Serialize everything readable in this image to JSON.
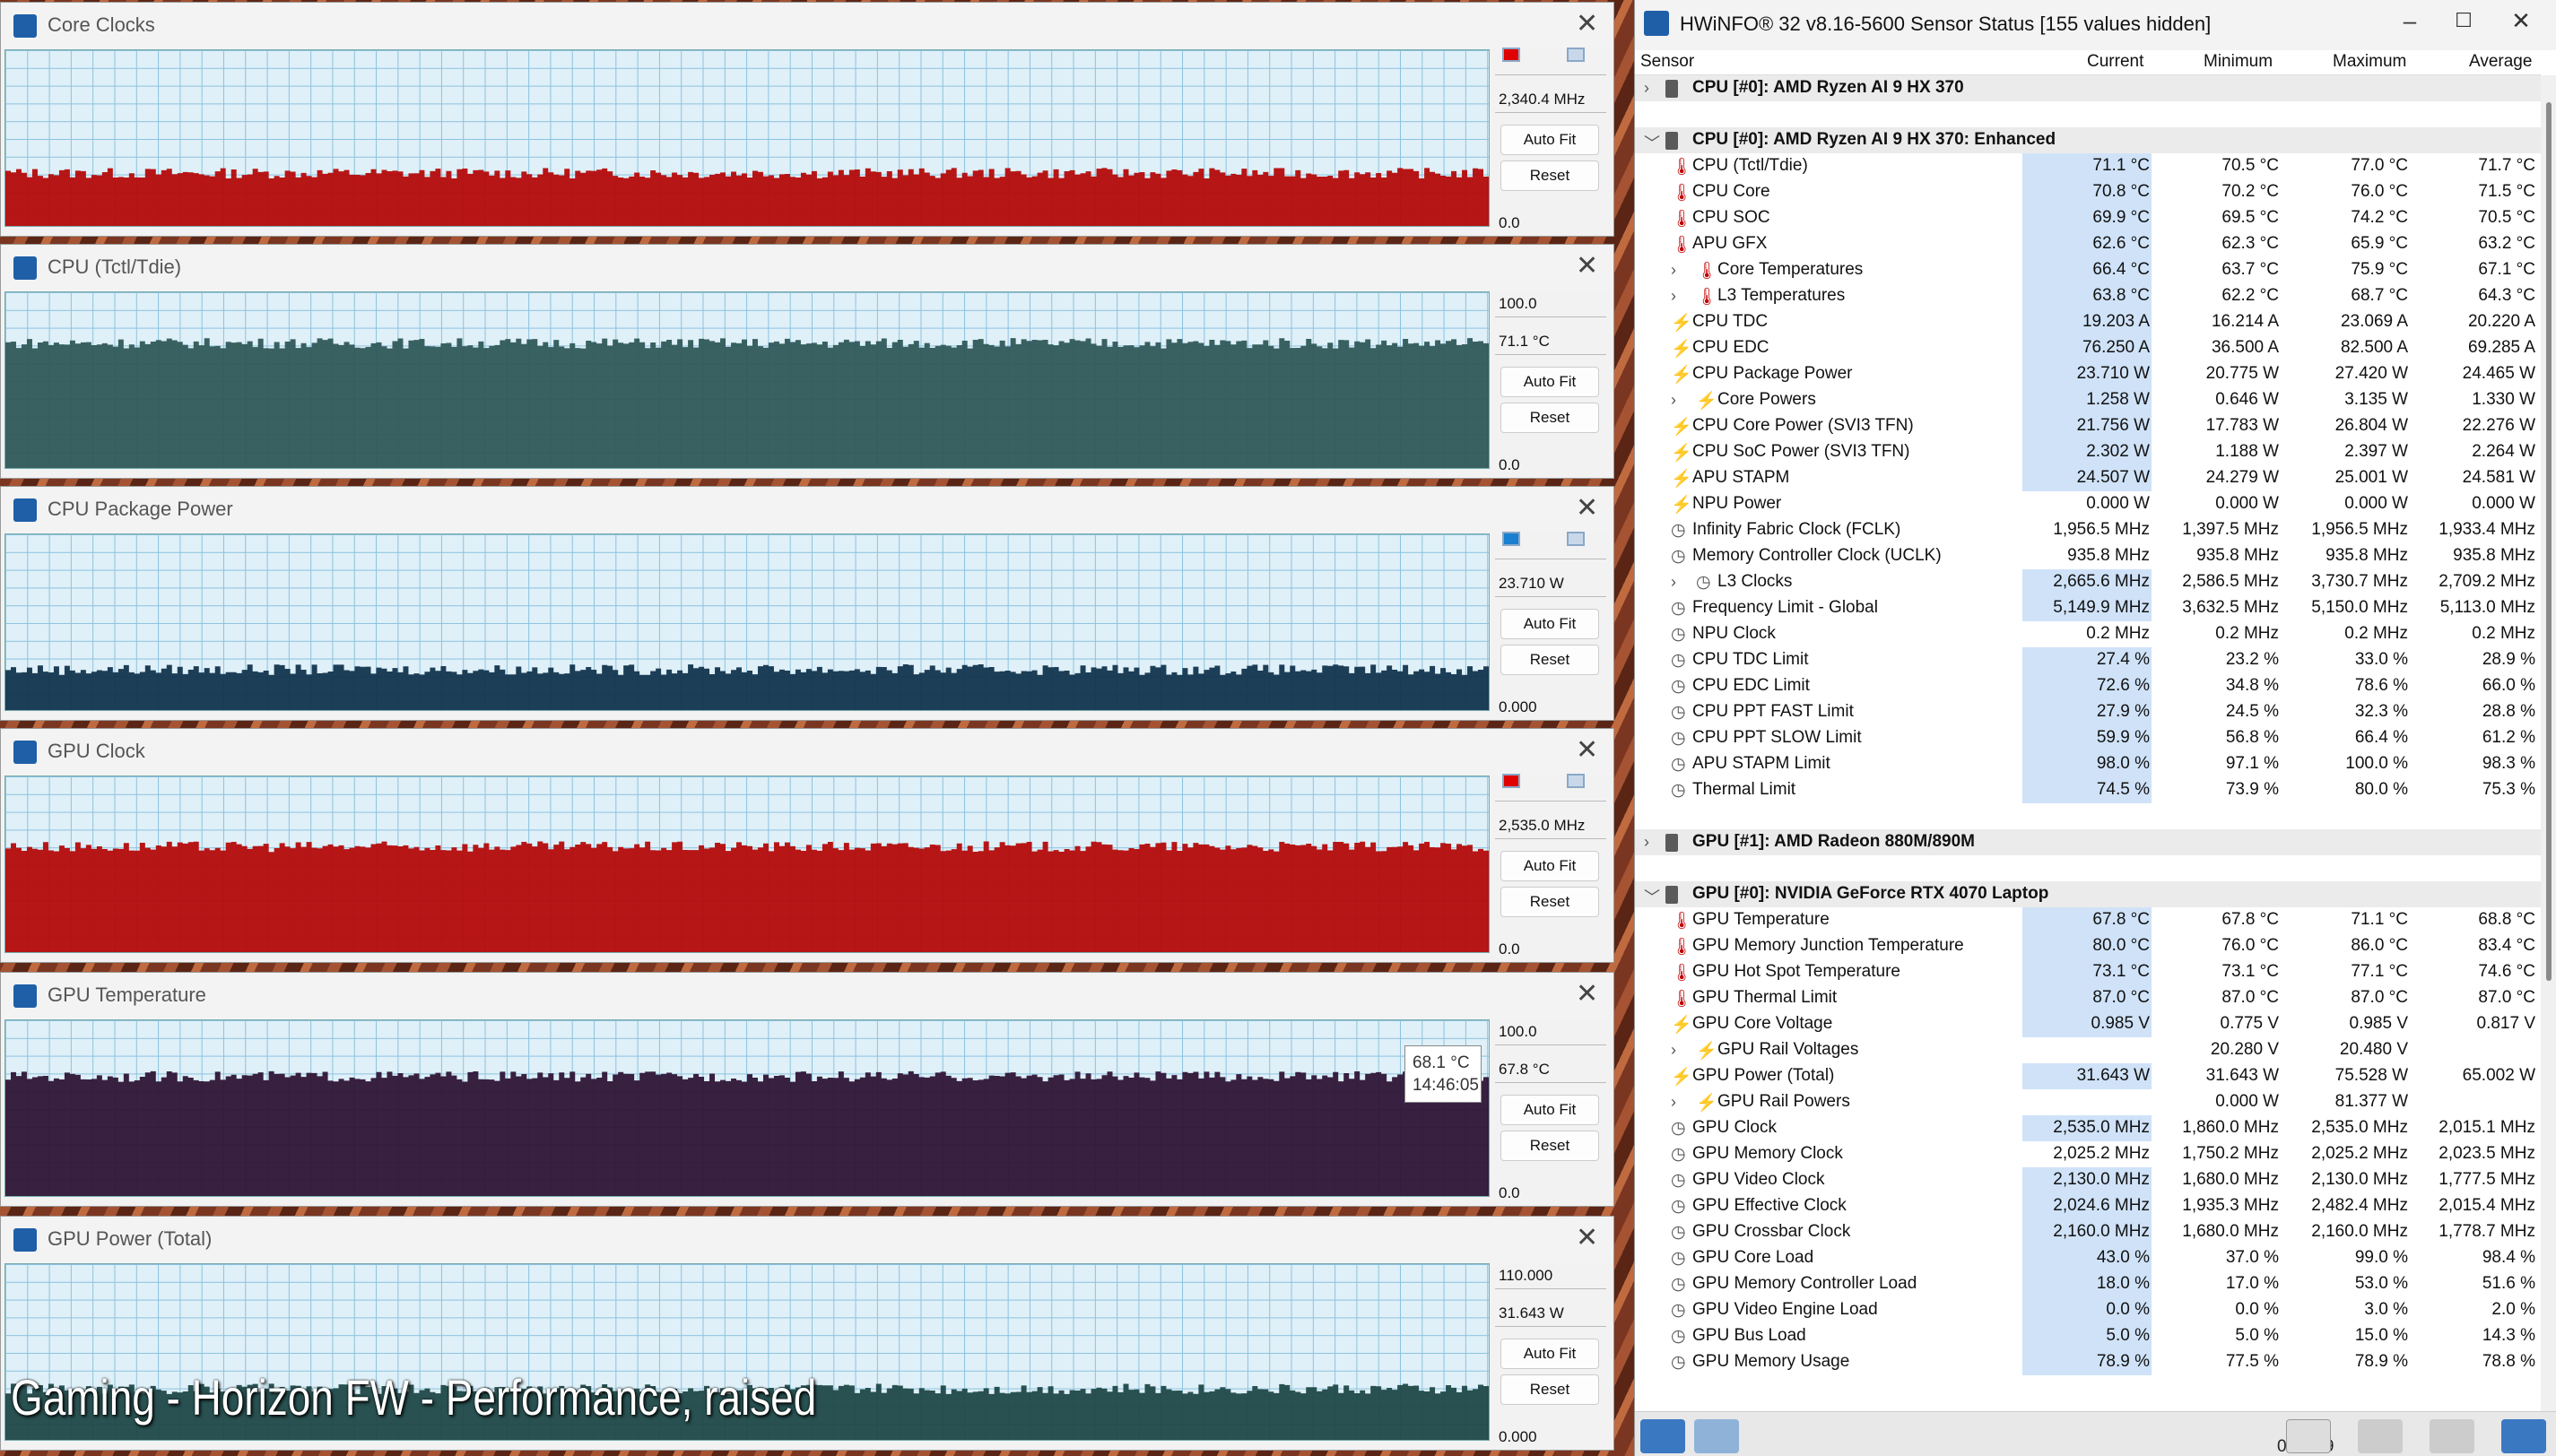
{
  "graphs": [
    {
      "title": "Core Clocks",
      "max": "",
      "cur": "2,340.4 MHz",
      "min": "0.0",
      "color": "#b40a0a",
      "fill_fraction": 0.3,
      "swatch": "#e00000",
      "autofit": "Auto Fit",
      "reset": "Reset"
    },
    {
      "title": "CPU (Tctl/Tdie)",
      "max": "100.0",
      "cur": "71.1 °C",
      "min": "0.0",
      "color": "#2f5858",
      "fill_fraction": 0.71,
      "swatch": "",
      "autofit": "Auto Fit",
      "reset": "Reset"
    },
    {
      "title": "CPU Package Power",
      "max": "",
      "cur": "23.710 W",
      "min": "0.000",
      "color": "#12344e",
      "fill_fraction": 0.23,
      "swatch": "#1a7fd0",
      "autofit": "Auto Fit",
      "reset": "Reset"
    },
    {
      "title": "GPU Clock",
      "max": "",
      "cur": "2,535.0 MHz",
      "min": "0.0",
      "color": "#b40a0a",
      "fill_fraction": 0.6,
      "swatch": "#e00000",
      "autofit": "Auto Fit",
      "reset": "Reset"
    },
    {
      "title": "GPU Temperature",
      "max": "100.0",
      "cur": "67.8 °C",
      "min": "0.0",
      "color": "#2e1436",
      "fill_fraction": 0.68,
      "swatch": "",
      "autofit": "Auto Fit",
      "reset": "Reset"
    },
    {
      "title": "GPU Power (Total)",
      "max": "110.000",
      "cur": "31.643 W",
      "min": "0.000",
      "color": "#1f4848",
      "fill_fraction": 0.29,
      "swatch": "",
      "autofit": "Auto Fit",
      "reset": "Reset"
    }
  ],
  "tooltip": {
    "value": "68.1 °C",
    "time": "14:46:05"
  },
  "caption": "Gaming - Horizon FW - Performance, raised",
  "hwinfo": {
    "title": "HWiNFO® 32 v8.16-5600 Sensor Status [155 values hidden]",
    "columns": [
      "Sensor",
      "Current",
      "Minimum",
      "Maximum",
      "Average"
    ],
    "rows": [
      {
        "t": "grp",
        "exp": ">",
        "name": "CPU [#0]: AMD Ryzen AI 9 HX 370"
      },
      {
        "t": "blank"
      },
      {
        "t": "grp",
        "exp": "v",
        "name": "CPU [#0]: AMD Ryzen AI 9 HX 370: Enhanced"
      },
      {
        "t": "s",
        "ic": "temp",
        "name": "CPU (Tctl/Tdie)",
        "cur": "71.1 °C",
        "min": "70.5 °C",
        "max": "77.0 °C",
        "avg": "71.7 °C",
        "hl": true
      },
      {
        "t": "s",
        "ic": "temp",
        "name": "CPU Core",
        "cur": "70.8 °C",
        "min": "70.2 °C",
        "max": "76.0 °C",
        "avg": "71.5 °C",
        "hl": true
      },
      {
        "t": "s",
        "ic": "temp",
        "name": "CPU SOC",
        "cur": "69.9 °C",
        "min": "69.5 °C",
        "max": "74.2 °C",
        "avg": "70.5 °C",
        "hl": true
      },
      {
        "t": "s",
        "ic": "temp",
        "name": "APU GFX",
        "cur": "62.6 °C",
        "min": "62.3 °C",
        "max": "65.9 °C",
        "avg": "63.2 °C",
        "hl": true
      },
      {
        "t": "s",
        "ic": "temp",
        "sub": true,
        "name": "Core Temperatures",
        "cur": "66.4 °C",
        "min": "63.7 °C",
        "max": "75.9 °C",
        "avg": "67.1 °C",
        "hl": true
      },
      {
        "t": "s",
        "ic": "temp",
        "sub": true,
        "name": "L3 Temperatures",
        "cur": "63.8 °C",
        "min": "62.2 °C",
        "max": "68.7 °C",
        "avg": "64.3 °C",
        "hl": true
      },
      {
        "t": "s",
        "ic": "bolt",
        "name": "CPU TDC",
        "cur": "19.203 A",
        "min": "16.214 A",
        "max": "23.069 A",
        "avg": "20.220 A",
        "hl": true
      },
      {
        "t": "s",
        "ic": "bolt",
        "name": "CPU EDC",
        "cur": "76.250 A",
        "min": "36.500 A",
        "max": "82.500 A",
        "avg": "69.285 A",
        "hl": true
      },
      {
        "t": "s",
        "ic": "bolt",
        "name": "CPU Package Power",
        "cur": "23.710 W",
        "min": "20.775 W",
        "max": "27.420 W",
        "avg": "24.465 W",
        "hl": true
      },
      {
        "t": "s",
        "ic": "bolt",
        "sub": true,
        "name": "Core Powers",
        "cur": "1.258 W",
        "min": "0.646 W",
        "max": "3.135 W",
        "avg": "1.330 W",
        "hl": true
      },
      {
        "t": "s",
        "ic": "bolt",
        "name": "CPU Core Power (SVI3 TFN)",
        "cur": "21.756 W",
        "min": "17.783 W",
        "max": "26.804 W",
        "avg": "22.276 W",
        "hl": true
      },
      {
        "t": "s",
        "ic": "bolt",
        "name": "CPU SoC Power (SVI3 TFN)",
        "cur": "2.302 W",
        "min": "1.188 W",
        "max": "2.397 W",
        "avg": "2.264 W",
        "hl": true
      },
      {
        "t": "s",
        "ic": "bolt",
        "name": "APU STAPM",
        "cur": "24.507 W",
        "min": "24.279 W",
        "max": "25.001 W",
        "avg": "24.581 W",
        "hl": true
      },
      {
        "t": "s",
        "ic": "bolt",
        "name": "NPU Power",
        "cur": "0.000 W",
        "min": "0.000 W",
        "max": "0.000 W",
        "avg": "0.000 W",
        "hl": false
      },
      {
        "t": "s",
        "ic": "clock",
        "name": "Infinity Fabric Clock (FCLK)",
        "cur": "1,956.5 MHz",
        "min": "1,397.5 MHz",
        "max": "1,956.5 MHz",
        "avg": "1,933.4 MHz",
        "hl": false
      },
      {
        "t": "s",
        "ic": "clock",
        "name": "Memory Controller Clock (UCLK)",
        "cur": "935.8 MHz",
        "min": "935.8 MHz",
        "max": "935.8 MHz",
        "avg": "935.8 MHz",
        "hl": false
      },
      {
        "t": "s",
        "ic": "clock",
        "sub": true,
        "name": "L3 Clocks",
        "cur": "2,665.6 MHz",
        "min": "2,586.5 MHz",
        "max": "3,730.7 MHz",
        "avg": "2,709.2 MHz",
        "hl": true
      },
      {
        "t": "s",
        "ic": "clock",
        "name": "Frequency Limit - Global",
        "cur": "5,149.9 MHz",
        "min": "3,632.5 MHz",
        "max": "5,150.0 MHz",
        "avg": "5,113.0 MHz",
        "hl": true
      },
      {
        "t": "s",
        "ic": "clock",
        "name": "NPU Clock",
        "cur": "0.2 MHz",
        "min": "0.2 MHz",
        "max": "0.2 MHz",
        "avg": "0.2 MHz",
        "hl": false
      },
      {
        "t": "s",
        "ic": "clock",
        "name": "CPU TDC Limit",
        "cur": "27.4 %",
        "min": "23.2 %",
        "max": "33.0 %",
        "avg": "28.9 %",
        "hl": true
      },
      {
        "t": "s",
        "ic": "clock",
        "name": "CPU EDC Limit",
        "cur": "72.6 %",
        "min": "34.8 %",
        "max": "78.6 %",
        "avg": "66.0 %",
        "hl": true
      },
      {
        "t": "s",
        "ic": "clock",
        "name": "CPU PPT FAST Limit",
        "cur": "27.9 %",
        "min": "24.5 %",
        "max": "32.3 %",
        "avg": "28.8 %",
        "hl": true
      },
      {
        "t": "s",
        "ic": "clock",
        "name": "CPU PPT SLOW Limit",
        "cur": "59.9 %",
        "min": "56.8 %",
        "max": "66.4 %",
        "avg": "61.2 %",
        "hl": true
      },
      {
        "t": "s",
        "ic": "clock",
        "name": "APU STAPM Limit",
        "cur": "98.0 %",
        "min": "97.1 %",
        "max": "100.0 %",
        "avg": "98.3 %",
        "hl": true
      },
      {
        "t": "s",
        "ic": "clock",
        "name": "Thermal Limit",
        "cur": "74.5 %",
        "min": "73.9 %",
        "max": "80.0 %",
        "avg": "75.3 %",
        "hl": true
      },
      {
        "t": "blank"
      },
      {
        "t": "grp",
        "exp": ">",
        "name": "GPU [#1]: AMD Radeon 880M/890M"
      },
      {
        "t": "blank"
      },
      {
        "t": "grp",
        "exp": "v",
        "name": "GPU [#0]: NVIDIA GeForce RTX 4070 Laptop"
      },
      {
        "t": "s",
        "ic": "temp",
        "name": "GPU Temperature",
        "cur": "67.8 °C",
        "min": "67.8 °C",
        "max": "71.1 °C",
        "avg": "68.8 °C",
        "hl": true
      },
      {
        "t": "s",
        "ic": "temp",
        "name": "GPU Memory Junction Temperature",
        "cur": "80.0 °C",
        "min": "76.0 °C",
        "max": "86.0 °C",
        "avg": "83.4 °C",
        "hl": true
      },
      {
        "t": "s",
        "ic": "temp",
        "name": "GPU Hot Spot Temperature",
        "cur": "73.1 °C",
        "min": "73.1 °C",
        "max": "77.1 °C",
        "avg": "74.6 °C",
        "hl": true
      },
      {
        "t": "s",
        "ic": "temp",
        "name": "GPU Thermal Limit",
        "cur": "87.0 °C",
        "min": "87.0 °C",
        "max": "87.0 °C",
        "avg": "87.0 °C",
        "hl": true
      },
      {
        "t": "s",
        "ic": "bolt",
        "name": "GPU Core Voltage",
        "cur": "0.985 V",
        "min": "0.775 V",
        "max": "0.985 V",
        "avg": "0.817 V",
        "hl": true
      },
      {
        "t": "s",
        "ic": "bolt",
        "sub": true,
        "name": "GPU Rail Voltages",
        "cur": "",
        "min": "20.280 V",
        "max": "20.480 V",
        "avg": "",
        "hl": false
      },
      {
        "t": "s",
        "ic": "bolt",
        "name": "GPU Power (Total)",
        "cur": "31.643 W",
        "min": "31.643 W",
        "max": "75.528 W",
        "avg": "65.002 W",
        "hl": true
      },
      {
        "t": "s",
        "ic": "bolt",
        "sub": true,
        "name": "GPU Rail Powers",
        "cur": "",
        "min": "0.000 W",
        "max": "81.377 W",
        "avg": "",
        "hl": false
      },
      {
        "t": "s",
        "ic": "clock",
        "name": "GPU Clock",
        "cur": "2,535.0 MHz",
        "min": "1,860.0 MHz",
        "max": "2,535.0 MHz",
        "avg": "2,015.1 MHz",
        "hl": true
      },
      {
        "t": "s",
        "ic": "clock",
        "name": "GPU Memory Clock",
        "cur": "2,025.2 MHz",
        "min": "1,750.2 MHz",
        "max": "2,025.2 MHz",
        "avg": "2,023.5 MHz",
        "hl": false
      },
      {
        "t": "s",
        "ic": "clock",
        "name": "GPU Video Clock",
        "cur": "2,130.0 MHz",
        "min": "1,680.0 MHz",
        "max": "2,130.0 MHz",
        "avg": "1,777.5 MHz",
        "hl": true
      },
      {
        "t": "s",
        "ic": "clock",
        "name": "GPU Effective Clock",
        "cur": "2,024.6 MHz",
        "min": "1,935.3 MHz",
        "max": "2,482.4 MHz",
        "avg": "2,015.4 MHz",
        "hl": true
      },
      {
        "t": "s",
        "ic": "clock",
        "name": "GPU Crossbar Clock",
        "cur": "2,160.0 MHz",
        "min": "1,680.0 MHz",
        "max": "2,160.0 MHz",
        "avg": "1,778.7 MHz",
        "hl": true
      },
      {
        "t": "s",
        "ic": "clock",
        "name": "GPU Core Load",
        "cur": "43.0 %",
        "min": "37.0 %",
        "max": "99.0 %",
        "avg": "98.4 %",
        "hl": true
      },
      {
        "t": "s",
        "ic": "clock",
        "name": "GPU Memory Controller Load",
        "cur": "18.0 %",
        "min": "17.0 %",
        "max": "53.0 %",
        "avg": "51.6 %",
        "hl": true
      },
      {
        "t": "s",
        "ic": "clock",
        "name": "GPU Video Engine Load",
        "cur": "0.0 %",
        "min": "0.0 %",
        "max": "3.0 %",
        "avg": "2.0 %",
        "hl": true
      },
      {
        "t": "s",
        "ic": "clock",
        "name": "GPU Bus Load",
        "cur": "5.0 %",
        "min": "5.0 %",
        "max": "15.0 %",
        "avg": "14.3 %",
        "hl": true
      },
      {
        "t": "s",
        "ic": "clock",
        "name": "GPU Memory Usage",
        "cur": "78.9 %",
        "min": "77.5 %",
        "max": "78.9 %",
        "avg": "78.8 %",
        "hl": true
      }
    ],
    "elapsed": "0:10:39"
  }
}
